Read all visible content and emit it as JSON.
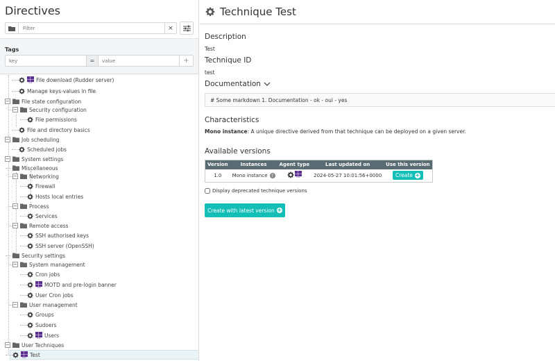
{
  "left": {
    "title": "Directives",
    "filter_placeholder": "Filter",
    "clear_symbol": "×",
    "tags_label": "Tags",
    "key_placeholder": "key",
    "equals_symbol": "=",
    "value_placeholder": "value",
    "add_symbol": "+"
  },
  "tree": {
    "items": [
      {
        "label": "File download (Rudder server)",
        "kind": "technique",
        "windows": true
      },
      {
        "label": "Manage keys-values in file",
        "kind": "technique",
        "windows": false
      },
      {
        "label": "File state configuration",
        "kind": "category"
      },
      {
        "label": "Security configuration",
        "kind": "category"
      },
      {
        "label": "File permissions",
        "kind": "technique",
        "windows": false
      },
      {
        "label": "File and directory basics",
        "kind": "technique",
        "windows": false
      },
      {
        "label": "Job scheduling",
        "kind": "category"
      },
      {
        "label": "Scheduled jobs",
        "kind": "technique",
        "windows": false
      },
      {
        "label": "System settings",
        "kind": "category"
      },
      {
        "label": "Miscellaneous",
        "kind": "folder"
      },
      {
        "label": "Networking",
        "kind": "category"
      },
      {
        "label": "Firewall",
        "kind": "technique",
        "windows": false
      },
      {
        "label": "Hosts local entries",
        "kind": "technique",
        "windows": false
      },
      {
        "label": "Process",
        "kind": "category"
      },
      {
        "label": "Services",
        "kind": "technique",
        "windows": false
      },
      {
        "label": "Remote access",
        "kind": "category"
      },
      {
        "label": "SSH authorised keys",
        "kind": "technique",
        "windows": false
      },
      {
        "label": "SSH server (OpenSSH)",
        "kind": "technique",
        "windows": false
      },
      {
        "label": "Security settings",
        "kind": "folder"
      },
      {
        "label": "System management",
        "kind": "category"
      },
      {
        "label": "Cron jobs",
        "kind": "technique",
        "windows": false
      },
      {
        "label": "MOTD and pre-login banner",
        "kind": "technique",
        "windows": true
      },
      {
        "label": "User Cron jobs",
        "kind": "technique",
        "windows": false
      },
      {
        "label": "User management",
        "kind": "category"
      },
      {
        "label": "Groups",
        "kind": "technique",
        "windows": false
      },
      {
        "label": "Sudoers",
        "kind": "technique",
        "windows": false
      },
      {
        "label": "Users",
        "kind": "technique",
        "windows": true
      },
      {
        "label": "User Techniques",
        "kind": "category"
      },
      {
        "label": "Test",
        "kind": "technique",
        "windows": true,
        "selected": true
      }
    ]
  },
  "main": {
    "title": "Technique Test",
    "description_label": "Description",
    "description_value": "Test",
    "technique_id_label": "Technique ID",
    "technique_id_value": "test",
    "documentation_label": "Documentation",
    "documentation_value": "# Some markdown 1. Documentation - ok - oui - yes",
    "characteristics_label": "Characteristics",
    "characteristics_bold": "Mono instance",
    "characteristics_text": ": A unique directive derived from that technique can be deployed on a given server.",
    "available_versions_label": "Available versions",
    "table": {
      "headers": [
        "Version",
        "Instances",
        "Agent type",
        "Last updated on",
        "Use this version"
      ],
      "row": {
        "version": "1.0",
        "instances": "Mono instance",
        "last_updated": "2024-05-27 10:01:56+0000",
        "action": "Create"
      }
    },
    "deprecated_label": "Display deprecated technique versions",
    "create_latest_label": "Create with latest version",
    "windows_tag": "DSC",
    "help_symbol": "?"
  },
  "colors": {
    "accent": "#13beb7",
    "table_header": "#5a6c73",
    "windows_purple": "#5b2d90"
  }
}
